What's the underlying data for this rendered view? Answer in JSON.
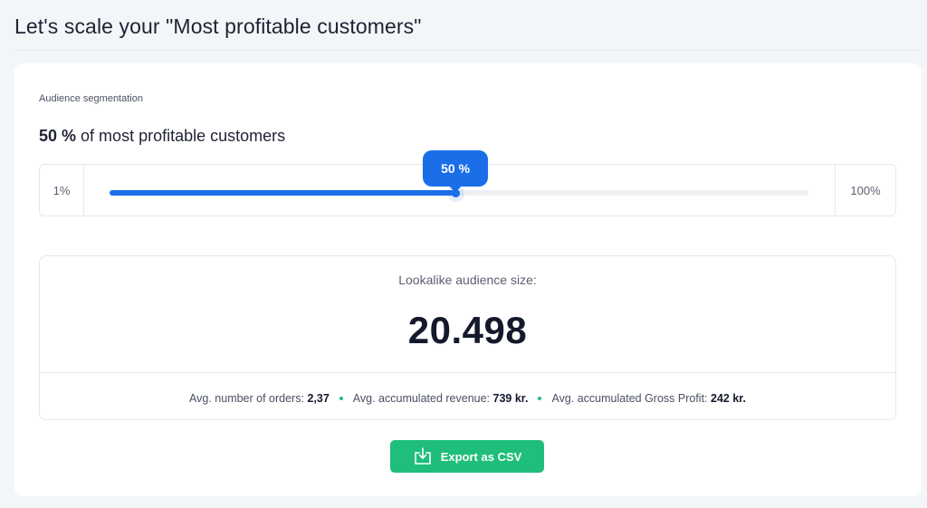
{
  "page": {
    "title": "Let's scale your \"Most profitable customers\""
  },
  "segmentation": {
    "label": "Audience segmentation",
    "percent_text": "50 %",
    "heading_suffix": "of most profitable customers",
    "slider": {
      "min_label": "1%",
      "max_label": "100%",
      "value": 50,
      "min": 1,
      "max": 100,
      "tooltip": "50 %"
    }
  },
  "audience": {
    "label": "Lookalike audience size:",
    "size": "20.498",
    "metrics": [
      {
        "label": "Avg. number of orders:",
        "value": "2,37"
      },
      {
        "label": "Avg. accumulated revenue:",
        "value": "739 kr."
      },
      {
        "label": "Avg. accumulated Gross Profit:",
        "value": "242 kr."
      }
    ]
  },
  "export": {
    "label": "Export as CSV",
    "icon": "download-tray-icon"
  },
  "colors": {
    "accent_blue": "#1a6fe8",
    "accent_green": "#1fbe7a",
    "background": "#f3f6f9"
  }
}
